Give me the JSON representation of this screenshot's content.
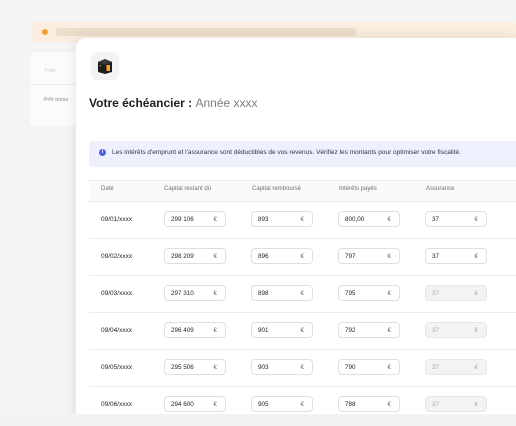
{
  "background": {
    "field_label": "Type",
    "field_value": "Prêt immo"
  },
  "modal": {
    "logo_icon": "bank-icon",
    "title": "Votre échéancier :",
    "subtitle": "Année xxxx",
    "info": "Les intérêts d'emprunt et l'assurance sont déductibles de vos revenus. Vérifiez les montants  pour optimiser votre fiscalité."
  },
  "table": {
    "columns": [
      "Date",
      "Capital restant dû",
      "Capital remboursé",
      "Intérêts payés",
      "Assurance"
    ],
    "currency": "€",
    "rows": [
      {
        "date": "09/01/xxxx",
        "capital_restant": "299 106",
        "capital_rembourse": "893",
        "interets": "800,00",
        "assurance": "37",
        "assurance_disabled": false
      },
      {
        "date": "09/02/xxxx",
        "capital_restant": "298 209",
        "capital_rembourse": "896",
        "interets": "797",
        "assurance": "37",
        "assurance_disabled": false
      },
      {
        "date": "09/03/xxxx",
        "capital_restant": "297 310",
        "capital_rembourse": "898",
        "interets": "795",
        "assurance": "37",
        "assurance_disabled": true
      },
      {
        "date": "09/04/xxxx",
        "capital_restant": "296 409",
        "capital_rembourse": "901",
        "interets": "792",
        "assurance": "37",
        "assurance_disabled": true
      },
      {
        "date": "09/05/xxxx",
        "capital_restant": "295 506",
        "capital_rembourse": "903",
        "interets": "790",
        "assurance": "37",
        "assurance_disabled": true
      },
      {
        "date": "09/06/xxxx",
        "capital_restant": "294 600",
        "capital_rembourse": "905",
        "interets": "788",
        "assurance": "37",
        "assurance_disabled": true
      }
    ]
  },
  "colors": {
    "accent": "#4d5fd6",
    "info_bg": "#eef1fd",
    "warning_bg": "#fbeee0"
  }
}
